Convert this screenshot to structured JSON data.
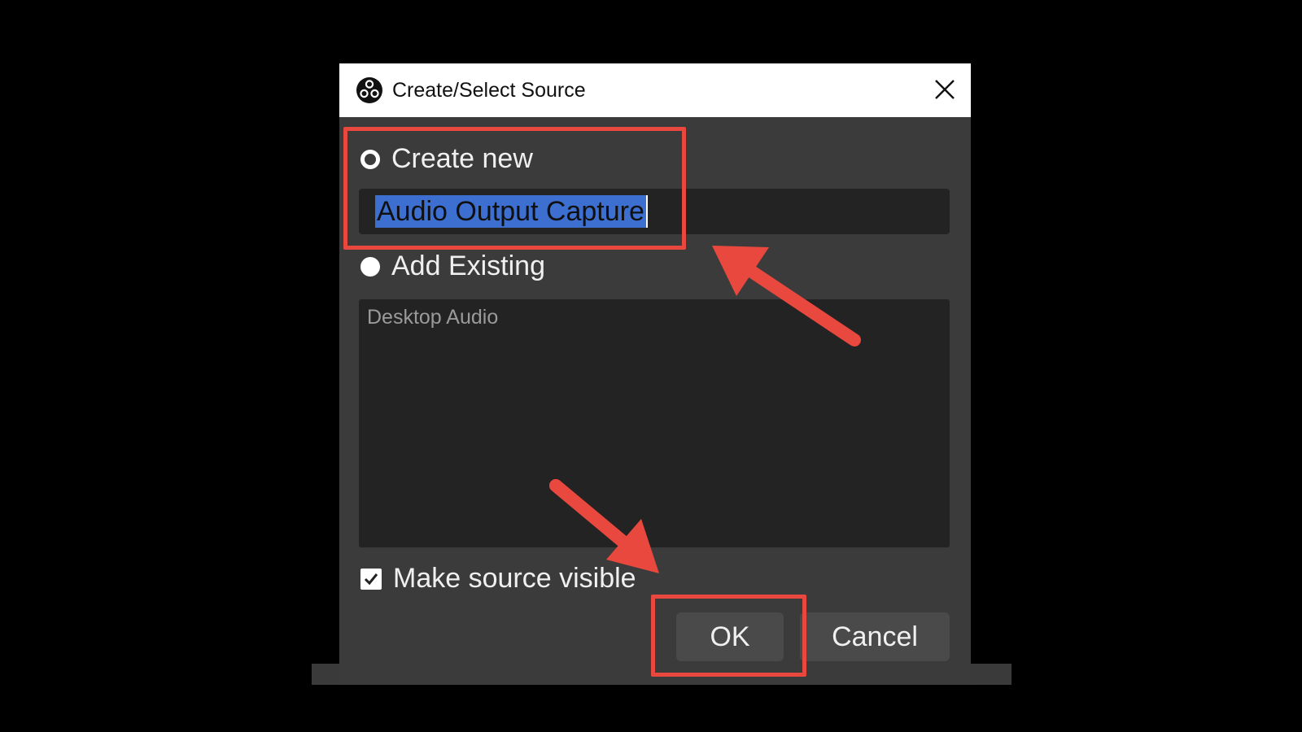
{
  "window": {
    "title": "Create/Select Source",
    "logo_icon": "obs-logo-icon",
    "close_icon": "close-icon"
  },
  "create_new": {
    "label": "Create new",
    "selected": false,
    "input_value": "Audio Output Capture"
  },
  "add_existing": {
    "label": "Add Existing",
    "selected": true,
    "items": [
      "Desktop Audio"
    ]
  },
  "visibility": {
    "label": "Make source visible",
    "checked": true
  },
  "buttons": {
    "ok": "OK",
    "cancel": "Cancel"
  },
  "annotation": {
    "highlight_color": "#e8483d"
  }
}
